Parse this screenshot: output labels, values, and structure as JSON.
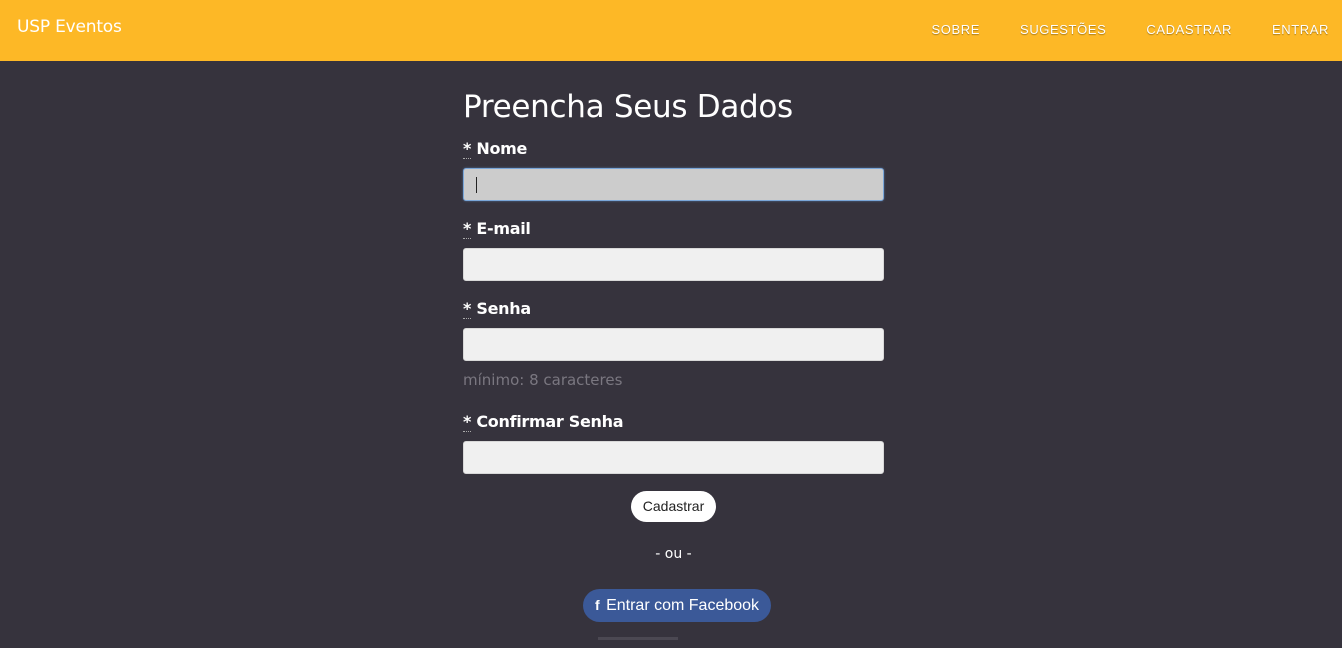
{
  "navbar": {
    "brand": "USP Eventos",
    "links": [
      {
        "label": "SOBRE"
      },
      {
        "label": "SUGESTÕES"
      },
      {
        "label": "CADASTRAR"
      },
      {
        "label": "ENTRAR"
      }
    ],
    "background_color": "#fdb826"
  },
  "form": {
    "title": "Preencha Seus Dados",
    "required_marker": "*",
    "fields": [
      {
        "label": "Nome",
        "value": "",
        "focused": true
      },
      {
        "label": "E-mail",
        "value": ""
      },
      {
        "label": "Senha",
        "value": "",
        "hint": "mínimo: 8 caracteres"
      },
      {
        "label": "Confirmar Senha",
        "value": ""
      }
    ],
    "submit_label": "Cadastrar",
    "divider": "- ou -",
    "facebook": {
      "icon": "facebook-f-icon",
      "icon_glyph": "f",
      "label": "Entrar com Facebook",
      "color": "#3b5998"
    }
  },
  "page_background": "#36333d"
}
